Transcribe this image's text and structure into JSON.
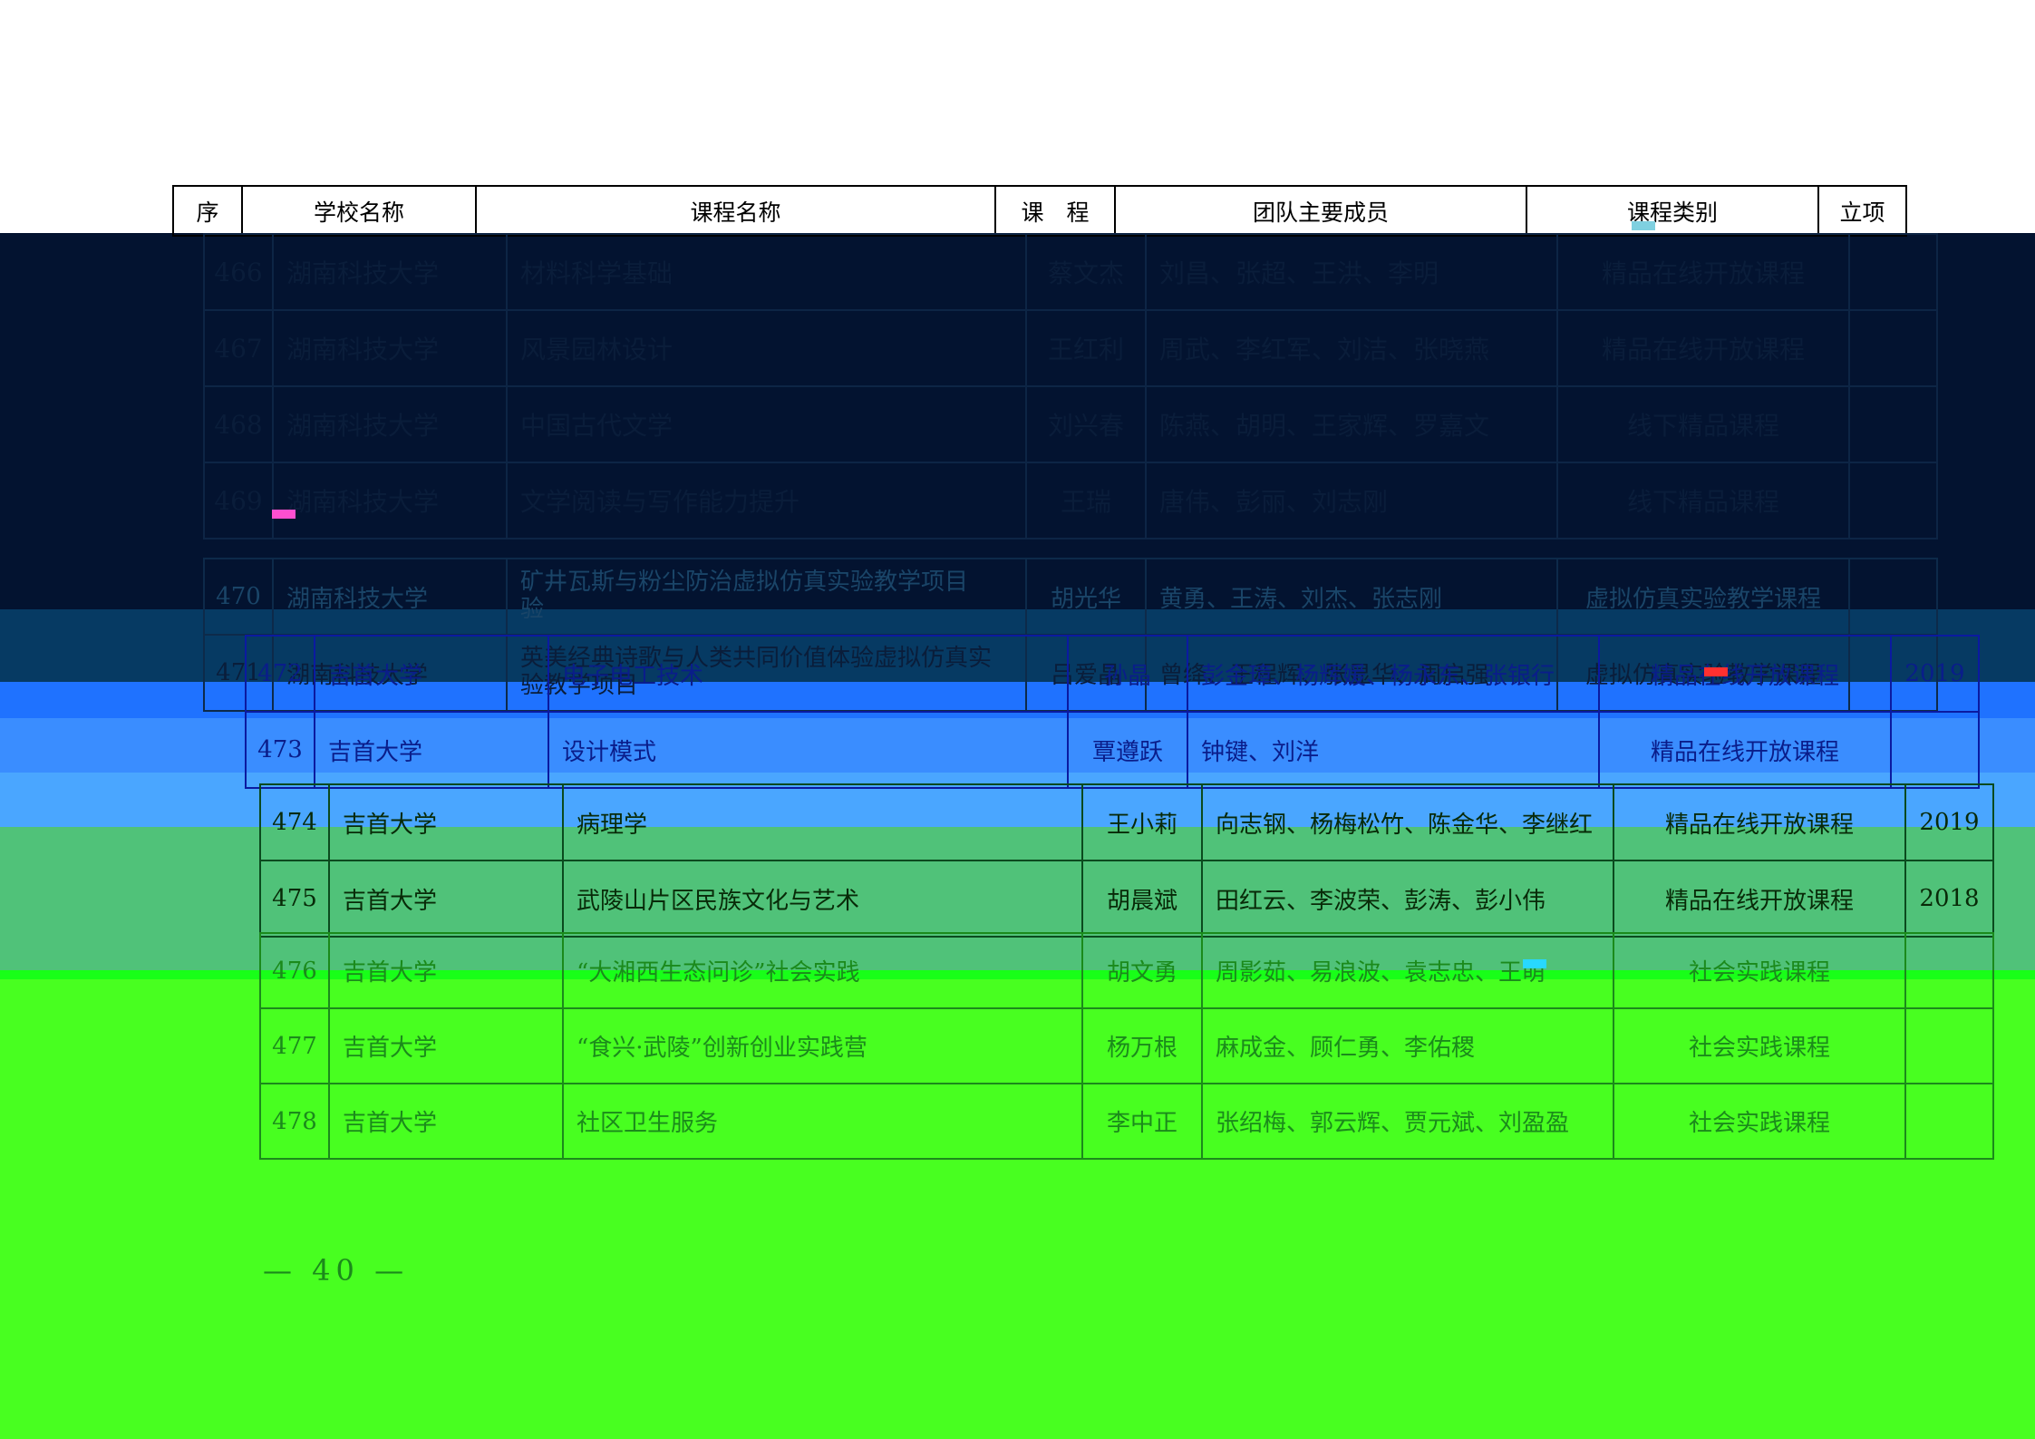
{
  "header": {
    "col_no": "序",
    "col_school": "学校名称",
    "col_course": "课程名称",
    "col_lead": "课　程",
    "col_team": "团队主要成员",
    "col_type": "课程类别",
    "col_year": "立项"
  },
  "dark_rows": [
    {
      "no": "466",
      "school": "湖南科技大学",
      "course": "材料科学基础",
      "lead": "蔡文杰",
      "team": "刘昌、张超、王洪、李明",
      "type": "精品在线开放课程",
      "year": ""
    },
    {
      "no": "467",
      "school": "湖南科技大学",
      "course": "风景园林设计",
      "lead": "王红利",
      "team": "周武、李红军、刘洁、张晓燕",
      "type": "精品在线开放课程",
      "year": ""
    },
    {
      "no": "468",
      "school": "湖南科技大学",
      "course": "中国古代文学",
      "lead": "刘兴春",
      "team": "陈燕、胡明、王家辉、罗嘉文",
      "type": "线下精品课程",
      "year": ""
    },
    {
      "no": "469",
      "school": "湖南科技大学",
      "course": "文学阅读与写作能力提升",
      "lead": "王瑞",
      "team": "唐伟、彭丽、刘志刚",
      "type": "线下精品课程",
      "year": ""
    }
  ],
  "teal_rows": [
    {
      "no": "470",
      "school": "湖南科技大学",
      "course": "矿井瓦斯与粉尘防治虚拟仿真实验教学项目",
      "course_tail": "验",
      "lead": "胡光华",
      "team": "黄勇、王涛、刘杰、张志刚",
      "type": "虚拟仿真实验教学课程",
      "year": ""
    },
    {
      "no": "471",
      "school": "湖南科技大学",
      "course": "英美经典诗歌与人类共同价值体验虚拟仿真实",
      "course_tail": "验教学项目",
      "lead": "吕爱晶",
      "team": "曾绛、王程辉、张显华、周启强",
      "type": "虚拟仿真实验教学课程",
      "year": ""
    }
  ],
  "blue_rows": [
    {
      "no": "472",
      "school": "吉首大学",
      "course": "电子电工技术",
      "lead": "孙晶",
      "team": "彭金璋、杨辉媛、杨永东、张银行",
      "type": "精品在线开放课程",
      "year": "2019"
    },
    {
      "no": "473",
      "school": "吉首大学",
      "course": "设计模式",
      "lead": "覃遵跃",
      "team": "钟键、刘洋",
      "type": "精品在线开放课程",
      "year": ""
    }
  ],
  "green_rows": [
    {
      "no": "474",
      "school": "吉首大学",
      "course": "病理学",
      "lead": "王小莉",
      "team": "向志钢、杨梅松竹、陈金华、李继红",
      "type": "精品在线开放课程",
      "year": "2019"
    },
    {
      "no": "475",
      "school": "吉首大学",
      "course": "武陵山片区民族文化与艺术",
      "lead": "胡晨斌",
      "team": "田红云、李波荣、彭涛、彭小伟",
      "type": "精品在线开放课程",
      "year": "2018"
    }
  ],
  "lime_rows": [
    {
      "no": "476",
      "school": "吉首大学",
      "course": "“大湘西生态问诊”社会实践",
      "lead": "胡文勇",
      "team": "周影茹、易浪波、袁志忠、王萌",
      "type": "社会实践课程",
      "year": ""
    },
    {
      "no": "477",
      "school": "吉首大学",
      "course": "“食兴·武陵”创新创业实践营",
      "lead": "杨万根",
      "team": "麻成金、顾仁勇、李佑稷",
      "type": "社会实践课程",
      "year": ""
    },
    {
      "no": "478",
      "school": "吉首大学",
      "course": "社区卫生服务",
      "lead": "李中正",
      "team": "张绍梅、郭云辉、贾元斌、刘盈盈",
      "type": "社会实践课程",
      "year": ""
    }
  ],
  "footer": {
    "page_number": "— 40 —"
  },
  "colors": {
    "navy": "#031330",
    "blue": "#1f72ff",
    "green": "#50c279",
    "lime": "#48ff20"
  }
}
